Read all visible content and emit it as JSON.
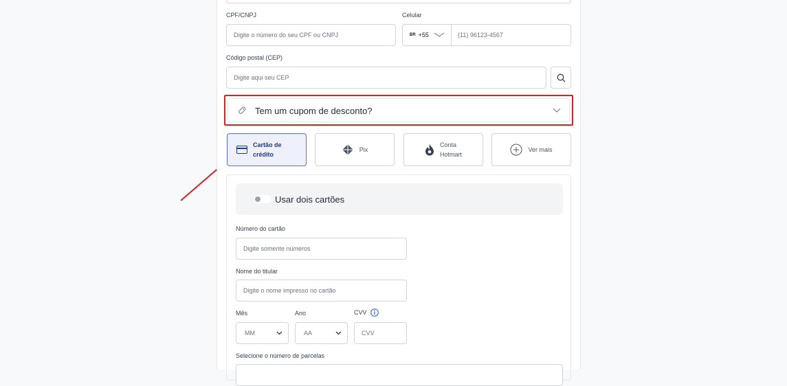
{
  "form": {
    "cpf": {
      "label": "CPF/CNPJ",
      "placeholder": "Digite o número do seu CPF ou CNPJ"
    },
    "phone": {
      "label": "Celular",
      "country_badge": "BR",
      "country_code": "+55",
      "placeholder": "(11) 96123-4567"
    },
    "cep": {
      "label": "Código postal (CEP)",
      "placeholder": "Digite aqui seu CEP"
    },
    "coupon": {
      "label": "Tem um cupom de desconto?"
    }
  },
  "payment_methods": {
    "credit_card": {
      "line1": "Cartão de",
      "line2": "crédito"
    },
    "pix": {
      "label": "Pix"
    },
    "hotmart": {
      "line1": "Conta",
      "line2": "Hotmart"
    },
    "more": {
      "label": "Ver mais"
    }
  },
  "card_form": {
    "two_cards_label": "Usar dois cartões",
    "card_number": {
      "label": "Número do cartão",
      "placeholder": "Digite somente números"
    },
    "holder_name": {
      "label": "Nome do titular",
      "placeholder": "Digite o nome impresso no cartão"
    },
    "month": {
      "label": "Mês",
      "value": "MM"
    },
    "year": {
      "label": "Ano",
      "value": "AA"
    },
    "cvv": {
      "label": "CVV",
      "placeholder": "CVV"
    },
    "installments": {
      "label": "Selecione o número de parcelas"
    }
  },
  "colors": {
    "highlight": "#e02020",
    "active_method_border": "#5b6fd6",
    "active_method_bg": "#eef1fb"
  }
}
